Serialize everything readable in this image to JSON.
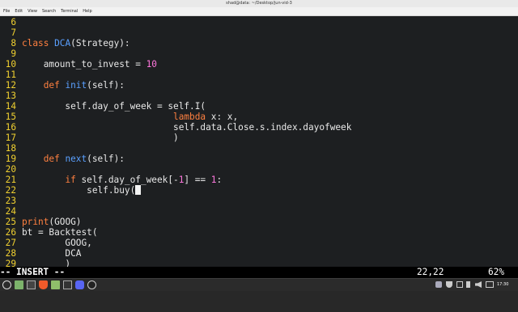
{
  "window": {
    "title": "shad@data: ~/Desktop/jun-vid-3"
  },
  "menu": {
    "items": [
      "File",
      "Edit",
      "View",
      "Search",
      "Terminal",
      "Help"
    ]
  },
  "editor": {
    "lines": [
      {
        "num": "6",
        "tokens": []
      },
      {
        "num": "7",
        "tokens": []
      },
      {
        "num": "8",
        "tokens": [
          {
            "t": "class",
            "c": "kw"
          },
          {
            "t": " "
          },
          {
            "t": "DCA",
            "c": "fn"
          },
          {
            "t": "(Strategy):"
          }
        ]
      },
      {
        "num": "9",
        "tokens": []
      },
      {
        "num": "10",
        "tokens": [
          {
            "t": "    amount_to_invest = "
          },
          {
            "t": "10",
            "c": "num"
          }
        ]
      },
      {
        "num": "11",
        "tokens": []
      },
      {
        "num": "12",
        "tokens": [
          {
            "t": "    "
          },
          {
            "t": "def",
            "c": "kw"
          },
          {
            "t": " "
          },
          {
            "t": "init",
            "c": "fn"
          },
          {
            "t": "(self):"
          }
        ]
      },
      {
        "num": "13",
        "tokens": []
      },
      {
        "num": "14",
        "tokens": [
          {
            "t": "        self.day_of_week = self.I("
          }
        ]
      },
      {
        "num": "15",
        "tokens": [
          {
            "t": "                            "
          },
          {
            "t": "lambda",
            "c": "kw"
          },
          {
            "t": " x: x,"
          }
        ]
      },
      {
        "num": "16",
        "tokens": [
          {
            "t": "                            self.data.Close.s.index.dayofweek"
          }
        ]
      },
      {
        "num": "17",
        "tokens": [
          {
            "t": "                            )"
          }
        ]
      },
      {
        "num": "18",
        "tokens": []
      },
      {
        "num": "19",
        "tokens": [
          {
            "t": "    "
          },
          {
            "t": "def",
            "c": "kw"
          },
          {
            "t": " "
          },
          {
            "t": "next",
            "c": "fn"
          },
          {
            "t": "(self):"
          }
        ]
      },
      {
        "num": "20",
        "tokens": []
      },
      {
        "num": "21",
        "tokens": [
          {
            "t": "        "
          },
          {
            "t": "if",
            "c": "kw"
          },
          {
            "t": " self.day_of_week[-"
          },
          {
            "t": "1",
            "c": "num"
          },
          {
            "t": "] == "
          },
          {
            "t": "1",
            "c": "num"
          },
          {
            "t": ":"
          }
        ]
      },
      {
        "num": "22",
        "tokens": [
          {
            "t": "            self.buy("
          }
        ],
        "cursor": true
      },
      {
        "num": "23",
        "tokens": []
      },
      {
        "num": "24",
        "tokens": []
      },
      {
        "num": "25",
        "tokens": [
          {
            "t": "print",
            "c": "kw"
          },
          {
            "t": "(GOOG)"
          }
        ]
      },
      {
        "num": "26",
        "tokens": [
          {
            "t": "bt = Backtest("
          }
        ]
      },
      {
        "num": "27",
        "tokens": [
          {
            "t": "        GOOG,"
          }
        ]
      },
      {
        "num": "28",
        "tokens": [
          {
            "t": "        DCA"
          }
        ]
      },
      {
        "num": "29",
        "tokens": [
          {
            "t": "        )"
          }
        ]
      }
    ]
  },
  "status": {
    "mode": "-- INSERT --",
    "position": "22,22",
    "percent": "62%"
  },
  "taskbar": {
    "icons": [
      "menu-icon",
      "files-icon",
      "terminal-icon",
      "brave-icon",
      "folder-icon",
      "terminal-icon",
      "discord-icon",
      "obs-icon"
    ],
    "tray": [
      "discord-icon",
      "shield-icon",
      "network-icon",
      "bluetooth-icon",
      "volume-icon",
      "battery-icon"
    ],
    "clock": "17:30"
  }
}
